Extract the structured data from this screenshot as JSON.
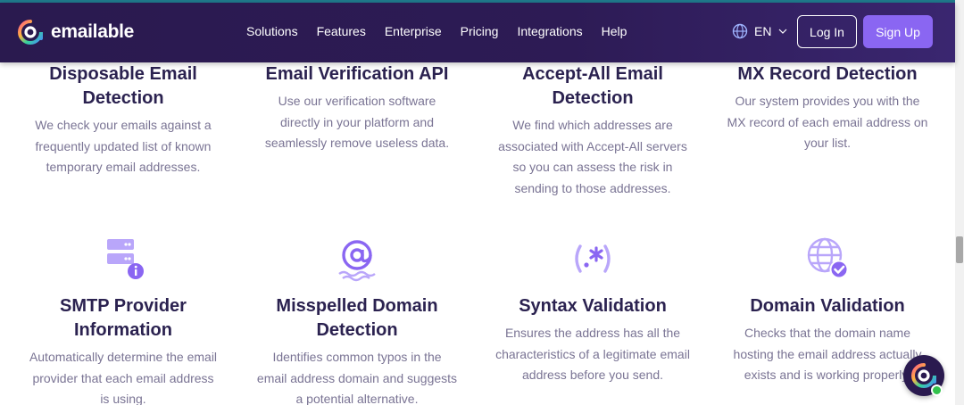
{
  "header": {
    "logo_text": "emailable",
    "nav": [
      "Solutions",
      "Features",
      "Enterprise",
      "Pricing",
      "Integrations",
      "Help"
    ],
    "language": "EN",
    "login_label": "Log In",
    "signup_label": "Sign Up"
  },
  "features_row1": [
    {
      "title_lines": [
        "Disposable Email",
        "Detection"
      ],
      "desc_lines": [
        "We check your emails against a",
        "frequently updated list of known",
        "temporary email addresses."
      ]
    },
    {
      "title_lines": [
        "Email Verification API"
      ],
      "desc_lines": [
        "Use our verification software",
        "directly in your platform and",
        "seamlessly remove useless data."
      ]
    },
    {
      "title_lines": [
        "Accept-All Email",
        "Detection"
      ],
      "desc_lines": [
        "We find which addresses are",
        "associated with Accept-All servers",
        "so you can assess the risk in",
        "sending to those addresses."
      ]
    },
    {
      "title_lines": [
        "MX Record Detection"
      ],
      "desc_lines": [
        "Our system provides you with the",
        "MX record of each email address on",
        "your list."
      ]
    }
  ],
  "features_row2": [
    {
      "icon": "server-info-icon",
      "title_lines": [
        "SMTP Provider",
        "Information"
      ],
      "desc_lines": [
        "Automatically determine the email",
        "provider that each email address",
        "is using."
      ]
    },
    {
      "icon": "at-sign-icon",
      "title_lines": [
        "Misspelled Domain",
        "Detection"
      ],
      "desc_lines": [
        "Identifies common typos in the",
        "email address domain and suggests",
        "a potential alternative."
      ]
    },
    {
      "icon": "regex-syntax-icon",
      "title_lines": [
        "Syntax Validation"
      ],
      "desc_lines": [
        "Ensures the address has all the",
        "characteristics of a legitimate email",
        "address before you send."
      ]
    },
    {
      "icon": "globe-check-icon",
      "title_lines": [
        "Domain Validation"
      ],
      "desc_lines": [
        "Checks that the domain name",
        "hosting the email address actually",
        "exists and is working properly."
      ]
    }
  ],
  "colors": {
    "header_bg": "#2d1b55",
    "accent": "#8a66f2",
    "title": "#2b2250",
    "desc": "#7a7494",
    "icon": "#9a7df5"
  }
}
